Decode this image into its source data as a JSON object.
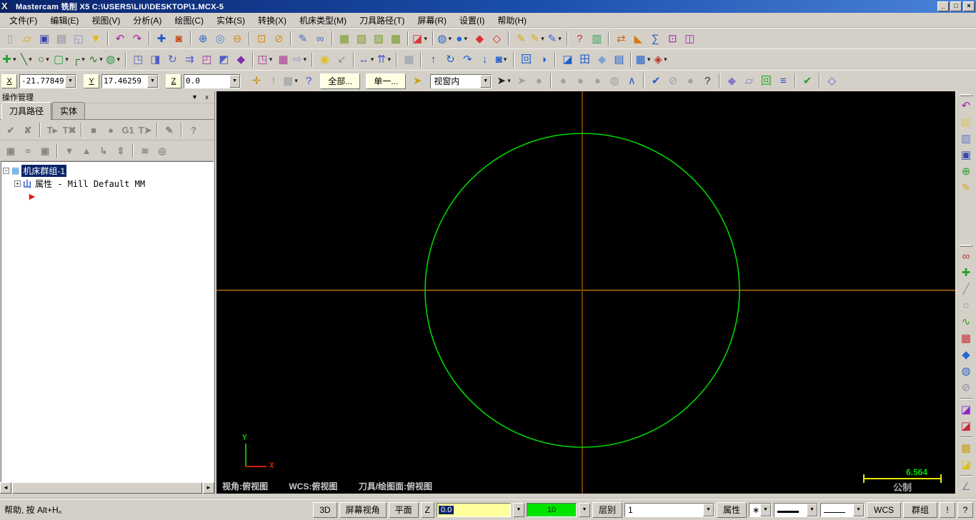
{
  "window": {
    "logo": "X",
    "title": "Mastercam 铣削 X5  C:\\USERS\\LIU\\DESKTOP\\1.MCX-5",
    "controls": [
      {
        "name": "minimize-button",
        "glyph": "_"
      },
      {
        "name": "restore-button",
        "glyph": "□"
      },
      {
        "name": "close-button",
        "glyph": "×"
      }
    ]
  },
  "menu": {
    "items": [
      {
        "name": "menu-file",
        "label": "文件(F)"
      },
      {
        "name": "menu-edit",
        "label": "编辑(E)"
      },
      {
        "name": "menu-view",
        "label": "视图(V)"
      },
      {
        "name": "menu-analyze",
        "label": "分析(A)"
      },
      {
        "name": "menu-create",
        "label": "绘图(C)"
      },
      {
        "name": "menu-solids",
        "label": "实体(S)"
      },
      {
        "name": "menu-xform",
        "label": "转换(X)"
      },
      {
        "name": "menu-machine-type",
        "label": "机床类型(M)"
      },
      {
        "name": "menu-toolpaths",
        "label": "刀具路径(T)"
      },
      {
        "name": "menu-screen",
        "label": "屏幕(R)"
      },
      {
        "name": "menu-settings",
        "label": "设置(I)"
      },
      {
        "name": "menu-help",
        "label": "帮助(H)"
      }
    ]
  },
  "toolbar1": {
    "items": [
      {
        "name": "new-file-icon",
        "glyph": "▯",
        "color": "#8ea0b8"
      },
      {
        "name": "open-file-icon",
        "glyph": "▱",
        "color": "#d8a018"
      },
      {
        "name": "save-icon",
        "glyph": "▣",
        "color": "#3844a8"
      },
      {
        "name": "print-icon",
        "glyph": "▤",
        "color": "#88889a"
      },
      {
        "name": "print-preview-icon",
        "glyph": "◱",
        "color": "#8898b8"
      },
      {
        "name": "filter-funnel-icon",
        "glyph": "▼",
        "color": "#e0b810"
      },
      {
        "sep": true
      },
      {
        "name": "undo-icon",
        "glyph": "↶",
        "color": "#a820a8"
      },
      {
        "name": "redo-icon",
        "glyph": "↷",
        "color": "#a820a8"
      },
      {
        "sep": true
      },
      {
        "name": "pan-icon",
        "glyph": "✚",
        "color": "#2458c8"
      },
      {
        "name": "dynamic-rotate-icon",
        "glyph": "◙",
        "color": "#c84818"
      },
      {
        "sep": true
      },
      {
        "name": "zoom-in-icon",
        "glyph": "⊕",
        "color": "#2868c8"
      },
      {
        "name": "zoom-window-icon",
        "glyph": "◎",
        "color": "#4888d8"
      },
      {
        "name": "zoom-out-icon",
        "glyph": "⊖",
        "color": "#d88818"
      },
      {
        "sep": true
      },
      {
        "name": "zoom-target-icon",
        "glyph": "⊡",
        "color": "#d88818"
      },
      {
        "name": "unzoom-icon",
        "glyph": "⊘",
        "color": "#d88818"
      },
      {
        "sep": true
      },
      {
        "name": "cursor-sketch-icon",
        "glyph": "✎",
        "color": "#4868c8"
      },
      {
        "name": "blank-screen-icon",
        "glyph": "∞",
        "color": "#4868c8"
      },
      {
        "sep": true
      },
      {
        "name": "gview-top-icon",
        "glyph": "▦",
        "color": "#7a9a28"
      },
      {
        "name": "gview-front-icon",
        "glyph": "▧",
        "color": "#7a9a28"
      },
      {
        "name": "gview-right-icon",
        "glyph": "▨",
        "color": "#7a9a28"
      },
      {
        "name": "gview-isometric-icon",
        "glyph": "▩",
        "color": "#7a9a28"
      },
      {
        "sep": true
      },
      {
        "name": "view-normal-icon",
        "glyph": "◪",
        "color": "#d83838",
        "dd": true
      },
      {
        "sep": true
      },
      {
        "name": "wcs-globe-icon",
        "glyph": "◍",
        "color": "#2868c8",
        "dd": true
      },
      {
        "name": "construction-plane-icon",
        "glyph": "●",
        "color": "#2860d8",
        "dd": true
      },
      {
        "name": "shaded-solid-icon",
        "glyph": "◆",
        "color": "#d83030"
      },
      {
        "name": "wireframe-solid-icon",
        "glyph": "◇",
        "color": "#d83030"
      },
      {
        "sep": true
      },
      {
        "name": "set-attributes-icon",
        "glyph": "✎",
        "color": "#d8a818"
      },
      {
        "name": "multi-edit-attributes-icon",
        "glyph": "✎",
        "color": "#e0b020",
        "dd": true
      },
      {
        "name": "clear-attributes-icon",
        "glyph": "✎",
        "color": "#4060d8",
        "dd": true
      },
      {
        "sep": true
      },
      {
        "name": "analyze-position-icon",
        "glyph": "?",
        "color": "#c83030"
      },
      {
        "name": "analyze-color-icon",
        "glyph": "▥",
        "color": "#38a058"
      },
      {
        "sep": true
      },
      {
        "name": "analyze-distance-icon",
        "glyph": "⇄",
        "color": "#c86818"
      },
      {
        "name": "analyze-dynamic-icon",
        "glyph": "◣",
        "color": "#d87818"
      },
      {
        "name": "analyze-volume-icon",
        "glyph": "∑",
        "color": "#2858c8"
      },
      {
        "name": "analyze-chain-icon",
        "glyph": "⊡",
        "color": "#a828a8"
      },
      {
        "name": "analyze-contour-icon",
        "glyph": "◫",
        "color": "#a828a8"
      }
    ]
  },
  "toolbar2": {
    "items": [
      {
        "name": "create-point-icon",
        "glyph": "✚",
        "color": "#28a030",
        "dd": true
      },
      {
        "name": "create-line-icon",
        "glyph": "╲",
        "color": "#287830",
        "dd": true
      },
      {
        "name": "create-arc-icon",
        "glyph": "○",
        "color": "#287830",
        "dd": true
      },
      {
        "name": "create-rectangle-icon",
        "glyph": "▢",
        "color": "#28a030",
        "dd": true
      },
      {
        "name": "create-fillet-icon",
        "glyph": "┌",
        "color": "#287830",
        "dd": true
      },
      {
        "name": "create-spline-icon",
        "glyph": "∿",
        "color": "#287830",
        "dd": true
      },
      {
        "name": "create-cylinder-icon",
        "glyph": "◍",
        "color": "#2a9a4a",
        "dd": true
      },
      {
        "sep": true
      },
      {
        "name": "xform-translate-icon",
        "glyph": "◳",
        "color": "#5060c8"
      },
      {
        "name": "xform-mirror-icon",
        "glyph": "◨",
        "color": "#5060c8"
      },
      {
        "name": "xform-rotate-icon",
        "glyph": "↻",
        "color": "#5060c8"
      },
      {
        "name": "xform-offset-icon",
        "glyph": "⇉",
        "color": "#5060c8"
      },
      {
        "name": "xform-scale-icon",
        "glyph": "◰",
        "color": "#a030a0"
      },
      {
        "name": "xform-move-icon",
        "glyph": "◩",
        "color": "#5060c8"
      },
      {
        "name": "xform-project-icon",
        "glyph": "◆",
        "color": "#8030b0"
      },
      {
        "sep": true
      },
      {
        "name": "nesting-icon",
        "glyph": "◳",
        "color": "#a83898",
        "dd": true
      },
      {
        "name": "grid-array-icon",
        "glyph": "▦",
        "color": "#a83898"
      },
      {
        "name": "stretch-icon",
        "glyph": "⇨",
        "color": "#8898c8",
        "dd": true
      },
      {
        "sep": true
      },
      {
        "name": "lightbulb-icon",
        "glyph": "◉",
        "color": "#e0c020"
      },
      {
        "name": "measure-arrow-icon",
        "glyph": "↙",
        "color": "#8890a8"
      },
      {
        "sep": true
      },
      {
        "name": "distance-icon",
        "glyph": "↔",
        "color": "#5060c8",
        "dd": true
      },
      {
        "name": "dimension-icon",
        "glyph": "⇈",
        "color": "#5060c8",
        "dd": true
      },
      {
        "sep": true
      },
      {
        "name": "hatch-icon",
        "glyph": "▩",
        "color": "#98a0a8"
      },
      {
        "sep": true
      },
      {
        "name": "solid-extrude-icon",
        "glyph": "↑",
        "color": "#2060d0"
      },
      {
        "name": "solid-revolve-icon",
        "glyph": "↻",
        "color": "#2060d0"
      },
      {
        "name": "solid-sweep-icon",
        "glyph": "↷",
        "color": "#2060d0"
      },
      {
        "name": "solid-loft-icon",
        "glyph": "↓",
        "color": "#2060d0"
      },
      {
        "name": "solid-fillet-icon",
        "glyph": "◙",
        "color": "#2060d0",
        "dd": true
      },
      {
        "sep": true
      },
      {
        "name": "solid-shell-icon",
        "glyph": "回",
        "color": "#2060d0"
      },
      {
        "name": "solid-boolean-icon",
        "glyph": "◑",
        "color": "#2060d0"
      },
      {
        "sep": true
      },
      {
        "name": "solid-chamfer-icon",
        "glyph": "◪",
        "color": "#2060d0"
      },
      {
        "name": "solid-history-icon",
        "glyph": "田",
        "color": "#2060d0"
      },
      {
        "name": "solid-trim-icon",
        "glyph": "◆",
        "color": "#80a0d8"
      },
      {
        "name": "solid-draft-icon",
        "glyph": "▤",
        "color": "#2060d0"
      },
      {
        "sep": true
      },
      {
        "name": "surface-create-icon",
        "glyph": "▦",
        "color": "#2060d0",
        "dd": true
      },
      {
        "name": "solid-combine-icon",
        "glyph": "◈",
        "color": "#c03030",
        "dd": true
      }
    ]
  },
  "toolbar3": {
    "axes": [
      {
        "name": "axis-x",
        "label": "X",
        "value": "-21.77849"
      },
      {
        "name": "axis-y",
        "label": "Y",
        "value": "17.46259"
      },
      {
        "name": "axis-z",
        "label": "Z",
        "value": "0.0"
      }
    ],
    "icons1": [
      {
        "name": "autocursor-icon",
        "glyph": "✛",
        "color": "#c89018"
      },
      {
        "name": "fastpoint-icon",
        "glyph": "!",
        "color": "#98a0a8"
      },
      {
        "name": "gview-select-icon",
        "glyph": "▦",
        "color": "#98a0a8",
        "dd": true
      },
      {
        "name": "help-icon",
        "glyph": "?",
        "color": "#3858c8"
      }
    ],
    "all_button": "全部...",
    "single_button": "单一...",
    "last_selection_icon": {
      "glyph": "➤",
      "color": "#c8a018"
    },
    "selection_mode": "视窗内",
    "icons2": [
      {
        "name": "select-arrow-icon",
        "glyph": "➤",
        "color": "#202020",
        "dd": true
      },
      {
        "name": "select-gray-arrow-icon",
        "glyph": "➤",
        "color": "#a0a0a0"
      },
      {
        "name": "select-result-icon",
        "glyph": "●",
        "color": "#a0a0a0"
      },
      {
        "sep": true
      },
      {
        "name": "select-polygon-icon",
        "glyph": "●",
        "color": "#a0a0a0"
      },
      {
        "name": "select-vector-icon",
        "glyph": "●",
        "color": "#a0a0a0"
      },
      {
        "name": "select-window-icon",
        "glyph": "●",
        "color": "#a0a0a0"
      },
      {
        "name": "select-solid-icon",
        "glyph": "◍",
        "color": "#a0a0a0"
      },
      {
        "name": "select-back-icon",
        "glyph": "∧",
        "color": "#2858d8"
      },
      {
        "sep": true
      },
      {
        "name": "validate-cursor-icon",
        "glyph": "✔",
        "color": "#2858c8"
      },
      {
        "name": "select-none-icon",
        "glyph": "⊘",
        "color": "#98a0a8"
      },
      {
        "name": "select-circle-icon",
        "glyph": "●",
        "color": "#a0a0a0"
      },
      {
        "name": "select-help-icon",
        "glyph": "?",
        "color": "#303030"
      },
      {
        "sep": true
      },
      {
        "name": "chain-start-icon",
        "glyph": "◆",
        "color": "#8878c8"
      },
      {
        "name": "chain-window-icon",
        "glyph": "▱",
        "color": "#8878c8"
      },
      {
        "name": "chain-spiral-icon",
        "glyph": "回",
        "color": "#28a828"
      },
      {
        "name": "chain-plane-icon",
        "glyph": "≡",
        "color": "#2858c8"
      },
      {
        "sep": true
      },
      {
        "name": "ok-check-icon",
        "glyph": "✔",
        "color": "#28a028"
      },
      {
        "sep": true
      },
      {
        "name": "expand-gview-icon",
        "glyph": "◇",
        "color": "#5868c8"
      }
    ]
  },
  "ops": {
    "title": "操作管理",
    "collapse_glyph": "▼",
    "close_glyph": "x",
    "tabs": [
      {
        "name": "tab-toolpaths",
        "label": "刀具路径",
        "active": true
      },
      {
        "name": "tab-solids",
        "label": "实体"
      }
    ],
    "icons_row1": [
      {
        "name": "select-all-operations-icon",
        "glyph": "✔"
      },
      {
        "name": "deselect-all-operations-icon",
        "glyph": "✘"
      },
      {
        "sep": true
      },
      {
        "name": "regen-selected-icon",
        "glyph": "T▸"
      },
      {
        "name": "regen-dirty-icon",
        "glyph": "T✖"
      },
      {
        "sep": true
      },
      {
        "name": "backplot-icon",
        "glyph": "■"
      },
      {
        "name": "verify-icon",
        "glyph": "●"
      },
      {
        "name": "g1-post-icon",
        "glyph": "G1"
      },
      {
        "name": "post-icon",
        "glyph": "T➤"
      },
      {
        "sep": true
      },
      {
        "name": "highfeed-icon",
        "glyph": "✎"
      },
      {
        "sep": true
      },
      {
        "name": "ops-help-icon",
        "glyph": "?"
      }
    ],
    "icons_row2": [
      {
        "name": "lock-icon",
        "glyph": "▣"
      },
      {
        "name": "toggle-toolpath-display-icon",
        "glyph": "≈"
      },
      {
        "name": "lock-posting-icon",
        "glyph": "▣"
      },
      {
        "sep": true
      },
      {
        "name": "move-down-icon",
        "glyph": "▼"
      },
      {
        "name": "move-up-icon",
        "glyph": "▲"
      },
      {
        "name": "insert-position-icon",
        "glyph": "↳"
      },
      {
        "name": "scroll-ops-icon",
        "glyph": "⇕"
      },
      {
        "sep": true
      },
      {
        "name": "trim-ops-icon",
        "glyph": "≋"
      },
      {
        "name": "ops-options-icon",
        "glyph": "◎"
      }
    ],
    "tree": {
      "minus": "−",
      "plus": "+",
      "items": [
        {
          "label": "机床群组-1"
        },
        {
          "label": "属性 - Mill Default MM"
        }
      ]
    },
    "scroll": {
      "left": "◄",
      "right": "►"
    }
  },
  "canvas": {
    "status": {
      "view": "视角:俯视图",
      "wcs": "WCS:俯视图",
      "cplane": "刀具/绘图面:俯视图"
    },
    "scale": {
      "value": "6.564",
      "unit": "公制"
    },
    "axis": {
      "x": "X",
      "y": "Y"
    },
    "colors": {
      "background": "#000000",
      "circle": "#00d400",
      "crosshair_h": "#8a5208",
      "crosshair_v": "#6e4106",
      "axis_x": "#cc2200",
      "axis_y": "#00bb00",
      "scale_line": "#e8e800",
      "scale_value": "#00dd00"
    }
  },
  "right_toolbar": {
    "items": [
      {
        "handle": true
      },
      {
        "name": "undo-icon",
        "glyph": "↶",
        "color": "#a020a0"
      },
      {
        "name": "clipboard-icon",
        "glyph": "▤",
        "color": "#d8c060"
      },
      {
        "name": "copy-icon",
        "glyph": "▥",
        "color": "#5878c8"
      },
      {
        "name": "save-icon",
        "glyph": "▣",
        "color": "#3848a8"
      },
      {
        "name": "create-circle-icon",
        "glyph": "⊕",
        "color": "#28a028"
      },
      {
        "name": "pencil-icon",
        "glyph": "✎",
        "color": "#d8a818"
      },
      {
        "gap": true
      },
      {
        "handle": true
      },
      {
        "name": "clear-colors-icon",
        "glyph": "∞",
        "color": "#c03030"
      },
      {
        "name": "add-geometry-icon",
        "glyph": "✚",
        "color": "#28a028"
      },
      {
        "name": "edit-line-icon",
        "glyph": "╱",
        "color": "#888ea0"
      },
      {
        "name": "edit-circle-icon",
        "glyph": "○",
        "color": "#888ea0"
      },
      {
        "name": "edit-spline-icon",
        "glyph": "∿",
        "color": "#28a028"
      },
      {
        "name": "edit-grid-icon",
        "glyph": "▦",
        "color": "#c83030"
      },
      {
        "name": "edit-solid-icon",
        "glyph": "◆",
        "color": "#2868d8"
      },
      {
        "name": "edit-surface-icon",
        "glyph": "◍",
        "color": "#2868c8"
      },
      {
        "name": "no-entry-icon",
        "glyph": "⊘",
        "color": "#888ea0"
      },
      {
        "sep": true
      },
      {
        "name": "attr-purple-icon",
        "glyph": "◪",
        "color": "#8828c8"
      },
      {
        "name": "attr-red-icon",
        "glyph": "◪",
        "color": "#c82838"
      },
      {
        "sep": true
      },
      {
        "name": "color-palette-icon",
        "glyph": "▦",
        "color": "#c8a018"
      },
      {
        "name": "attr-yellow-icon",
        "glyph": "◪",
        "color": "#d8c018"
      },
      {
        "sep": true
      },
      {
        "name": "analyze-angle-icon",
        "glyph": "∠",
        "color": "#888ea0"
      }
    ]
  },
  "statusbar": {
    "help": "帮助, 按 Alt+H。",
    "btn_3d": "3D",
    "screen_view": "屏幕视角",
    "plane": "平面",
    "z_label": "Z",
    "z_value": "0.0",
    "color_value": "10",
    "color_swatch": "#00e400",
    "level_label": "层别",
    "level_value": "1",
    "attributes": "属性",
    "point_style": "∗",
    "wcs": "WCS",
    "group": "群组",
    "exclaim": "!",
    "question": "?"
  }
}
